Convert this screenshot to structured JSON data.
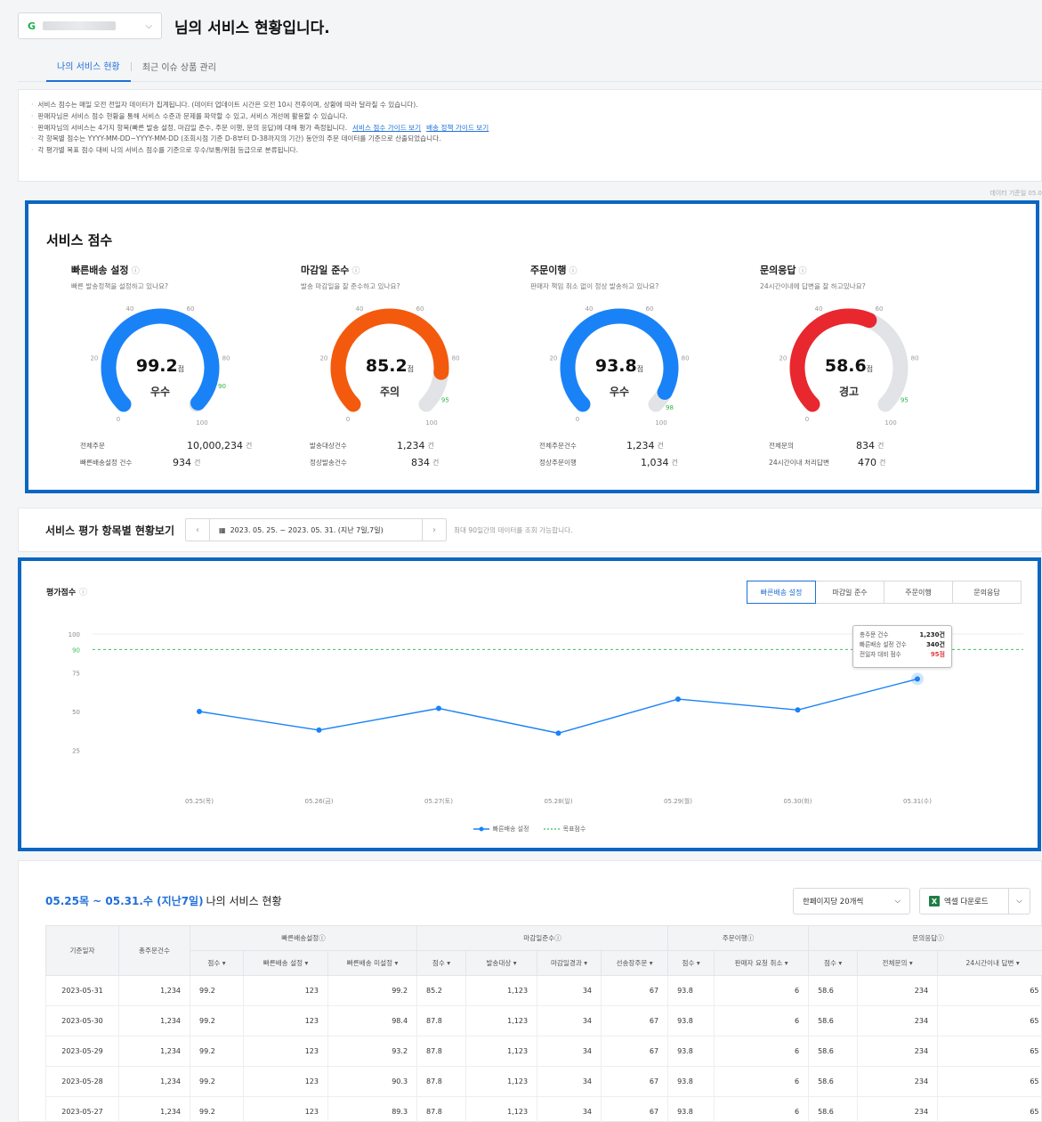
{
  "header": {
    "seller_prefix": "G",
    "title": "님의 서비스 현황입니다."
  },
  "tabs": [
    {
      "label": "나의 서비스 현황",
      "active": true
    },
    {
      "label": "최근 이슈 상품 관리",
      "active": false
    }
  ],
  "notice": {
    "lines": [
      "서비스 점수는 매일 오전 전일자 데이터가 집계됩니다. (데이터 업데이트 시간은 오전 10시 전후이며, 상황에 따라 달라질 수 있습니다).",
      "판매자님은 서비스 점수 현황을 통해 서비스 수준과 문제를 파악할 수 있고, 서비스 개선에 활용할 수 있습니다.",
      "판매자님의 서비스는 4가지 항목(빠른 발송 설정, 마감일 준수, 주문 이행, 문의 응답)에 대해 평가 측정됩니다.",
      "각 항목별 점수는 YYYY-MM-DD~YYYY-MM-DD (조회시점 기준 D-8부터 D-38까지의 기간) 동안의 주문 데이터를 기준으로 산출되었습니다.",
      "각 평가별 목표 점수 대비 나의 서비스 점수를 기준으로 우수/보통/위험 등급으로 분류됩니다."
    ],
    "link1": "서비스 점수 가이드 보기",
    "link2": "배송 정책 가이드 보기",
    "stamp": "데이터 기준일 05.0"
  },
  "score_section": {
    "title": "서비스 점수",
    "info_icon": "ⓘ",
    "gauge_ticks": [
      "0",
      "20",
      "40",
      "60",
      "80",
      "100"
    ],
    "unit": "점",
    "count_unit": "건",
    "cards": [
      {
        "title": "빠른배송 설정",
        "desc": "빠른 발송정책을 설정하고 있나요?",
        "score": "99.2",
        "value": 99.2,
        "target": "90",
        "target_value": 90,
        "grade": "우수",
        "color": "#1a82f7",
        "stats": [
          {
            "k": "전체주문",
            "v": "10,000,234"
          },
          {
            "k": "빠른배송설정 건수",
            "v": "934"
          }
        ]
      },
      {
        "title": "마감일 준수",
        "desc": "발송 마감일을 잘 준수하고 있나요?",
        "score": "85.2",
        "value": 85.2,
        "target": "95",
        "target_value": 95,
        "grade": "주의",
        "color": "#f35a0e",
        "stats": [
          {
            "k": "발송대상건수",
            "v": "1,234"
          },
          {
            "k": "정상발송건수",
            "v": "834"
          }
        ]
      },
      {
        "title": "주문이행",
        "desc": "판매자 책임 취소 없이 정상 발송하고 있나요?",
        "score": "93.8",
        "value": 93.8,
        "target": "98",
        "target_value": 98,
        "grade": "우수",
        "color": "#1a82f7",
        "stats": [
          {
            "k": "전체주문건수",
            "v": "1,234"
          },
          {
            "k": "정상주문이행",
            "v": "1,034"
          }
        ]
      },
      {
        "title": "문의응답",
        "desc": "24시간이내에 답변을 잘 하고있나요?",
        "score": "58.6",
        "value": 58.6,
        "target": "95",
        "target_value": 95,
        "grade": "경고",
        "color": "#e8282e",
        "stats": [
          {
            "k": "전체문의",
            "v": "834"
          },
          {
            "k": "24시간이내 처리답변",
            "v": "470"
          }
        ]
      }
    ]
  },
  "period": {
    "title": "서비스 평가 항목별 현황보기",
    "range": "2023. 05. 25. ~ 2023. 05. 31. (지난 7일,7일)",
    "note": "최대 90일간의 데이터를 조회 가능합니다."
  },
  "chart_section": {
    "label": "평가점수",
    "tabs": [
      {
        "label": "빠른배송 설정",
        "active": true
      },
      {
        "label": "마감일 준수",
        "active": false
      },
      {
        "label": "주문이행",
        "active": false
      },
      {
        "label": "문의응답",
        "active": false
      }
    ],
    "tooltip": [
      {
        "k": "총주문 건수",
        "v": "1,230건"
      },
      {
        "k": "빠른배송 설정 건수",
        "v": "340건"
      },
      {
        "k": "전일자 대비 점수",
        "v": "95점"
      }
    ]
  },
  "chart_data": {
    "type": "line",
    "x": [
      "05.25(목)",
      "05.26(금)",
      "05.27(토)",
      "05.28(일)",
      "05.29(월)",
      "05.30(화)",
      "05.31(수)"
    ],
    "series": [
      {
        "name": "빠른배송 설정",
        "values": [
          50,
          38,
          52,
          36,
          58,
          51,
          71
        ],
        "color": "#1a82f7"
      }
    ],
    "target": {
      "name": "목표점수",
      "value": 90,
      "color": "#3cc15a"
    },
    "yticks": [
      25,
      50,
      75,
      90,
      100
    ],
    "ylim": [
      0,
      100
    ],
    "grid": false,
    "legend": "bottom-center"
  },
  "table_section": {
    "title_range": "05.25목 ~ 05.31.수 (지난7일)",
    "title_rest": "나의 서비스 현황",
    "page_size": "한페이지당 20개씩",
    "excel": "엑셀 다운로드",
    "group_headers": [
      "기준일자",
      "총주문건수",
      "빠른배송설정ⓘ",
      "마감일준수ⓘ",
      "주문이행ⓘ",
      "문의응답ⓘ"
    ],
    "sub_headers": [
      "점수 ▾",
      "빠른배송 설정 ▾",
      "빠른배송 미설정 ▾",
      "점수 ▾",
      "발송대상 ▾",
      "마감일경과 ▾",
      "선송장주문 ▾",
      "점수 ▾",
      "판매자 요청 취소 ▾",
      "점수 ▾",
      "전체문의 ▾",
      "24시간이내 답변 ▾"
    ],
    "rows": [
      [
        "2023-05-31",
        "1,234",
        "99.2",
        "123",
        "99.2",
        "85.2",
        "1,123",
        "34",
        "67",
        "93.8",
        "6",
        "58.6",
        "234",
        "65"
      ],
      [
        "2023-05-30",
        "1,234",
        "99.2",
        "123",
        "98.4",
        "87.8",
        "1,123",
        "34",
        "67",
        "93.8",
        "6",
        "58.6",
        "234",
        "65"
      ],
      [
        "2023-05-29",
        "1,234",
        "99.2",
        "123",
        "93.2",
        "87.8",
        "1,123",
        "34",
        "67",
        "93.8",
        "6",
        "58.6",
        "234",
        "65"
      ],
      [
        "2023-05-28",
        "1,234",
        "99.2",
        "123",
        "90.3",
        "87.8",
        "1,123",
        "34",
        "67",
        "93.8",
        "6",
        "58.6",
        "234",
        "65"
      ],
      [
        "2023-05-27",
        "1,234",
        "99.2",
        "123",
        "89.3",
        "87.8",
        "1,123",
        "34",
        "67",
        "93.8",
        "6",
        "58.6",
        "234",
        "65"
      ]
    ]
  }
}
